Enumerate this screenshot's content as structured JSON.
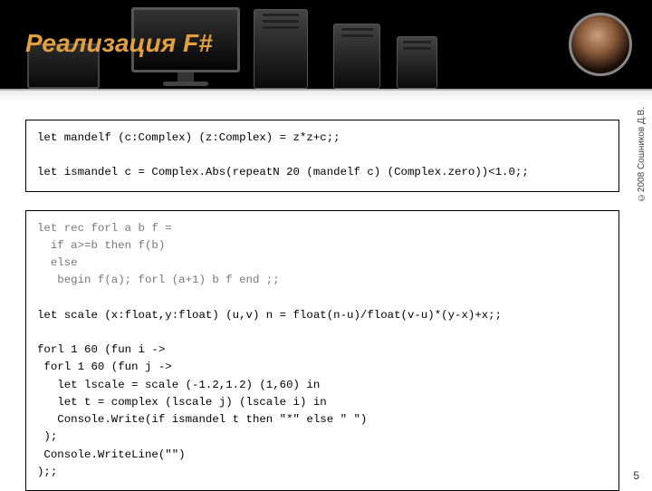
{
  "header": {
    "title": "Реализация F#"
  },
  "code1": {
    "line1": "let mandelf (c:Complex) (z:Complex) = z*z+c;;",
    "blank": "",
    "line2": "let ismandel c = Complex.Abs(repeatN 20 (mandelf c) (Complex.zero))<1.0;;"
  },
  "code2": {
    "faded1": "let rec forl a b f =",
    "faded2": "  if a>=b then f(b)",
    "faded3": "  else",
    "faded4": "   begin f(a); forl (a+1) b f end ;;",
    "blank1": "",
    "line1": "let scale (x:float,y:float) (u,v) n = float(n-u)/float(v-u)*(y-x)+x;;",
    "blank2": "",
    "line2": "forl 1 60 (fun i ->",
    "line3": " forl 1 60 (fun j ->",
    "line4": "   let lscale = scale (-1.2,1.2) (1,60) in",
    "line5": "   let t = complex (lscale j) (lscale i) in",
    "line6": "   Console.Write(if ismandel t then \"*\" else \" \")",
    "line7": " );",
    "line8": " Console.WriteLine(\"\")",
    "line9": ");;"
  },
  "meta": {
    "copyright": "©2008 Сошников Д.В.",
    "page": "5"
  }
}
